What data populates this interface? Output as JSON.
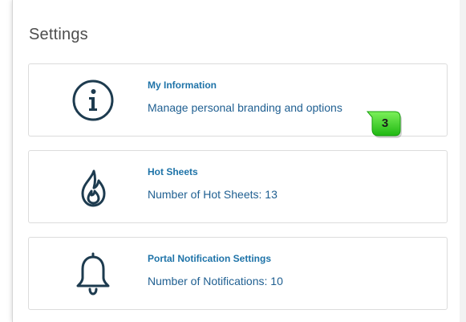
{
  "page": {
    "title": "Settings"
  },
  "cards": [
    {
      "icon": "info-icon",
      "name": "My Information",
      "description": "Manage personal branding and options"
    },
    {
      "icon": "flame-icon",
      "name": "Hot Sheets",
      "description": "Number of Hot Sheets: 13"
    },
    {
      "icon": "bell-icon",
      "name": "Portal Notification Settings",
      "description": "Number of Notifications: 10"
    }
  ],
  "step_badge": {
    "number": "3",
    "color": "#2ecc1a"
  },
  "colors": {
    "link": "#1e73a8",
    "text_dark_blue": "#1f5f91",
    "icon": "#1d3b4f"
  }
}
